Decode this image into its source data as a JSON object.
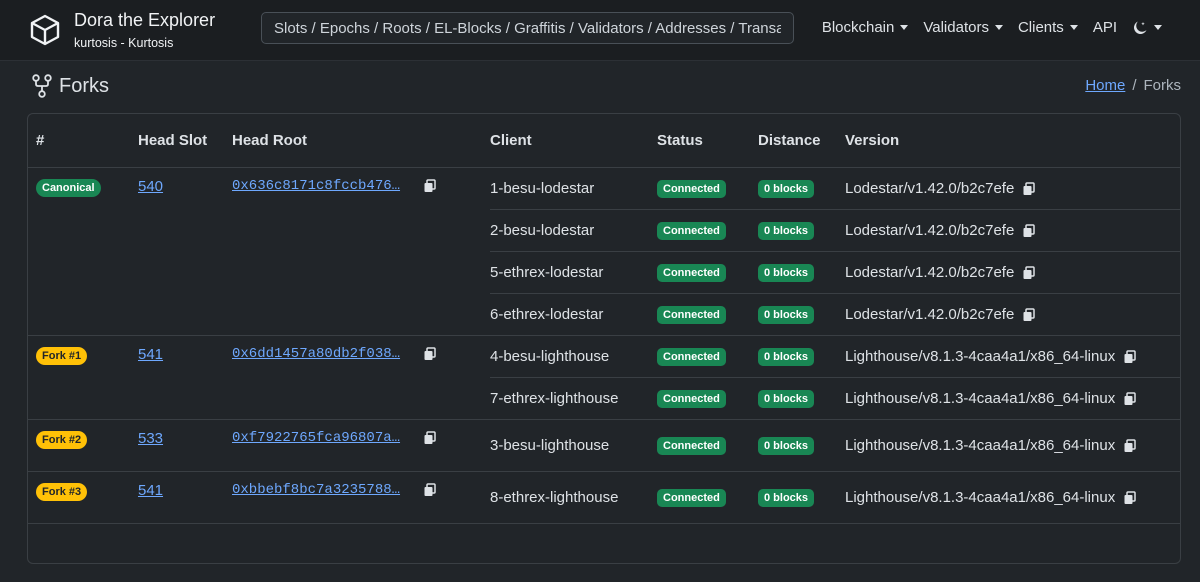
{
  "navbar": {
    "title": "Dora the Explorer",
    "subtitle": "kurtosis - Kurtosis",
    "search_placeholder": "Slots / Epochs / Roots / EL-Blocks / Graffitis / Validators / Addresses / Transac",
    "items": [
      {
        "label": "Blockchain",
        "dropdown": true
      },
      {
        "label": "Validators",
        "dropdown": true
      },
      {
        "label": "Clients",
        "dropdown": true
      },
      {
        "label": "API",
        "dropdown": false
      }
    ]
  },
  "page": {
    "title": "Forks",
    "breadcrumb_home": "Home",
    "breadcrumb_current": "Forks"
  },
  "table": {
    "headers": [
      "#",
      "Head Slot",
      "Head Root",
      "Client",
      "Status",
      "Distance",
      "Version"
    ],
    "groups": [
      {
        "badge": "Canonical",
        "badge_type": "canonical",
        "slot": "540",
        "root": "0x636c8171c8fccb476…",
        "clients": [
          {
            "name": "1-besu-lodestar",
            "status": "Connected",
            "distance": "0 blocks",
            "version": "Lodestar/v1.42.0/b2c7efe"
          },
          {
            "name": "2-besu-lodestar",
            "status": "Connected",
            "distance": "0 blocks",
            "version": "Lodestar/v1.42.0/b2c7efe"
          },
          {
            "name": "5-ethrex-lodestar",
            "status": "Connected",
            "distance": "0 blocks",
            "version": "Lodestar/v1.42.0/b2c7efe"
          },
          {
            "name": "6-ethrex-lodestar",
            "status": "Connected",
            "distance": "0 blocks",
            "version": "Lodestar/v1.42.0/b2c7efe"
          }
        ]
      },
      {
        "badge": "Fork #1",
        "badge_type": "fork",
        "slot": "541",
        "root": "0x6dd1457a80db2f038…",
        "clients": [
          {
            "name": "4-besu-lighthouse",
            "status": "Connected",
            "distance": "0 blocks",
            "version": "Lighthouse/v8.1.3-4caa4a1/x86_64-linux"
          },
          {
            "name": "7-ethrex-lighthouse",
            "status": "Connected",
            "distance": "0 blocks",
            "version": "Lighthouse/v8.1.3-4caa4a1/x86_64-linux"
          }
        ]
      },
      {
        "badge": "Fork #2",
        "badge_type": "fork",
        "slot": "533",
        "root": "0xf7922765fca96807a…",
        "clients": [
          {
            "name": "3-besu-lighthouse",
            "status": "Connected",
            "distance": "0 blocks",
            "version": "Lighthouse/v8.1.3-4caa4a1/x86_64-linux"
          }
        ]
      },
      {
        "badge": "Fork #3",
        "badge_type": "fork",
        "slot": "541",
        "root": "0xbbebf8bc7a3235788…",
        "clients": [
          {
            "name": "8-ethrex-lighthouse",
            "status": "Connected",
            "distance": "0 blocks",
            "version": "Lighthouse/v8.1.3-4caa4a1/x86_64-linux"
          }
        ]
      }
    ]
  }
}
